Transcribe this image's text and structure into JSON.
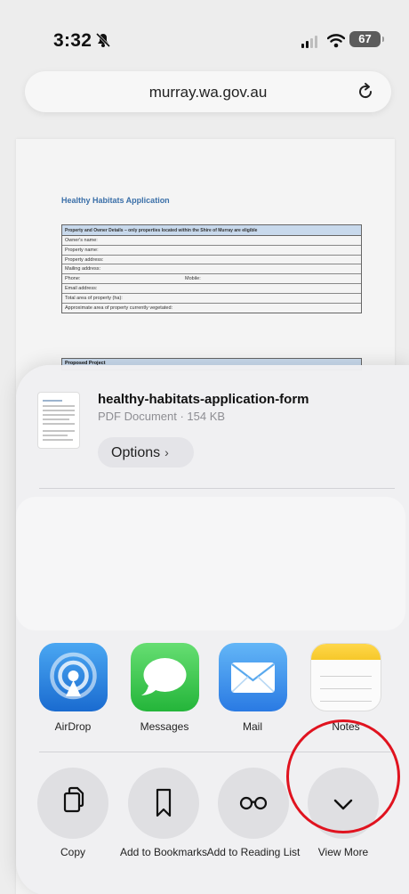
{
  "status_bar": {
    "time": "3:32",
    "battery": "67"
  },
  "address_bar": {
    "url": "murray.wa.gov.au"
  },
  "pdf": {
    "title": "Healthy Habitats Application",
    "section_header": "Property and Owner Details – only properties located within the Shire of Murray are eligible",
    "rows": [
      "Owner's name:",
      "Property name:",
      "Property address:",
      "Mailing address:",
      "Phone:",
      "Email address:",
      "Total area of property (ha):",
      "Approximate area of property currently vegetated:"
    ],
    "mobile_label": "Mobile:",
    "next_section": "Proposed Project"
  },
  "share_sheet": {
    "file_name": "healthy-habitats-application-form",
    "file_meta": "PDF Document · 154 KB",
    "options_label": "Options",
    "apps": [
      {
        "label": "AirDrop",
        "icon": "airdrop-icon"
      },
      {
        "label": "Messages",
        "icon": "messages-icon"
      },
      {
        "label": "Mail",
        "icon": "mail-icon"
      },
      {
        "label": "Notes",
        "icon": "notes-icon"
      }
    ],
    "actions": [
      {
        "label": "Copy",
        "icon": "copy-icon"
      },
      {
        "label": "Add to Bookmarks",
        "icon": "bookmark-icon"
      },
      {
        "label": "Add to Reading List",
        "icon": "glasses-icon"
      },
      {
        "label": "View More",
        "icon": "chevron-down-icon"
      }
    ]
  },
  "colors": {
    "highlight": "#e0131f",
    "pdf_accent": "#3a6fa8"
  }
}
